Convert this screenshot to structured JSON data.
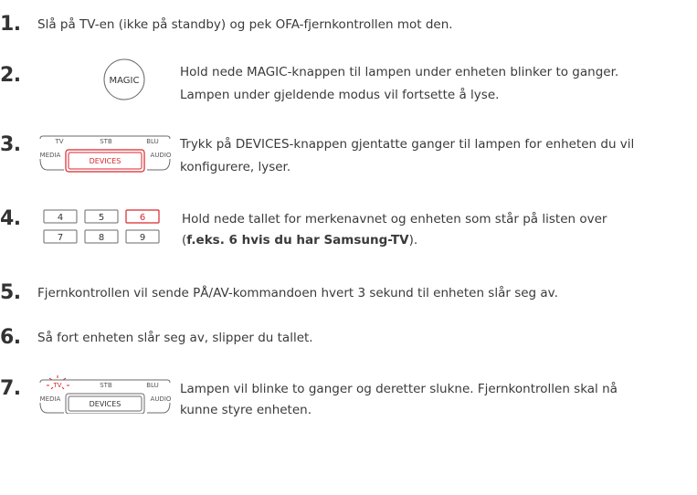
{
  "steps": [
    {
      "number": "1.",
      "text": "Slå på TV-en (ikke på standby) og pek OFA-fjernkontrollen mot den."
    },
    {
      "number": "2.",
      "icon_label": "MAGIC",
      "line1": "Hold nede MAGIC-knappen til lampen under enheten blinker to ganger.",
      "line2": "Lampen under gjeldende modus vil fortsette å lyse."
    },
    {
      "number": "3.",
      "line1": "Trykk på DEVICES-knappen gjentatte ganger til lampen for enheten du vil",
      "line2": "konfigurere, lyser."
    },
    {
      "number": "4.",
      "line1": "Hold nede tallet for merkenavnet og enheten som står på listen over",
      "line2_prefix": "(",
      "line2_bold": "f.eks. 6 hvis du har Samsung-TV",
      "line2_suffix": ")."
    },
    {
      "number": "5.",
      "text": "Fjernkontrollen vil sende PÅ/AV-kommandoen hvert 3 sekund til enheten slår seg av."
    },
    {
      "number": "6.",
      "text": "Så fort enheten slår seg av, slipper du tallet."
    },
    {
      "number": "7.",
      "line1": "Lampen vil blinke to ganger og deretter slukne. Fjernkontrollen skal nå",
      "line2": "kunne styre enheten."
    }
  ],
  "devices_panel": {
    "top_labels": [
      "TV",
      "STB",
      "BLU"
    ],
    "media_label": "MEDIA",
    "audio_label": "AUDIO",
    "button_label": "DEVICES"
  },
  "keypad": {
    "row1": [
      "4",
      "5",
      "6"
    ],
    "row2": [
      "7",
      "8",
      "9"
    ],
    "highlighted_key": "6"
  },
  "colors": {
    "accent_red": "#d9262c",
    "text": "#3a3a3a",
    "outline": "#6a6a6a"
  }
}
